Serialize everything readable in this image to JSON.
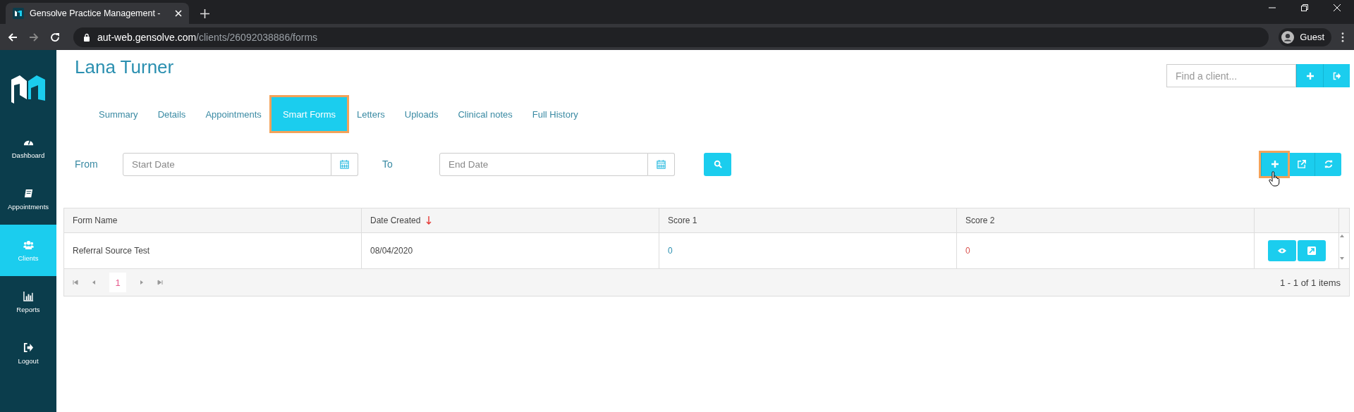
{
  "browser": {
    "tab_title": "Gensolve Practice Management -",
    "url_host": "aut-web.gensolve.com",
    "url_path": "/clients/26092038886/forms",
    "profile": "Guest"
  },
  "sidebar": {
    "items": [
      {
        "label": "Dashboard",
        "selected": false
      },
      {
        "label": "Appointments",
        "selected": false
      },
      {
        "label": "Clients",
        "selected": true
      },
      {
        "label": "Reports",
        "selected": false
      },
      {
        "label": "Logout",
        "selected": false
      }
    ]
  },
  "client_name": "Lana Turner",
  "client_search": {
    "placeholder": "Find a client..."
  },
  "tabs": [
    {
      "label": "Summary",
      "selected": false,
      "highlighted": false
    },
    {
      "label": "Details",
      "selected": false,
      "highlighted": false
    },
    {
      "label": "Appointments",
      "selected": false,
      "highlighted": false
    },
    {
      "label": "Smart Forms",
      "selected": true,
      "highlighted": true
    },
    {
      "label": "Letters",
      "selected": false,
      "highlighted": false
    },
    {
      "label": "Uploads",
      "selected": false,
      "highlighted": false
    },
    {
      "label": "Clinical notes",
      "selected": false,
      "highlighted": false
    },
    {
      "label": "Full History",
      "selected": false,
      "highlighted": false
    }
  ],
  "filters": {
    "from_label": "From",
    "from_placeholder": "Start Date",
    "to_label": "To",
    "to_placeholder": "End Date"
  },
  "toolbar": [
    {
      "highlighted": true
    },
    {
      "highlighted": false
    },
    {
      "highlighted": false
    }
  ],
  "table": {
    "columns": [
      {
        "label": "Form Name",
        "sorted": false
      },
      {
        "label": "Date Created",
        "sorted": true
      },
      {
        "label": "Score 1",
        "sorted": false
      },
      {
        "label": "Score 2",
        "sorted": false
      }
    ],
    "rows": [
      {
        "cells": [
          "Referral Source Test",
          "08/04/2020",
          "0",
          "0"
        ]
      }
    ]
  },
  "pager": {
    "page": "1",
    "summary": "1 - 1 of 1 items"
  }
}
